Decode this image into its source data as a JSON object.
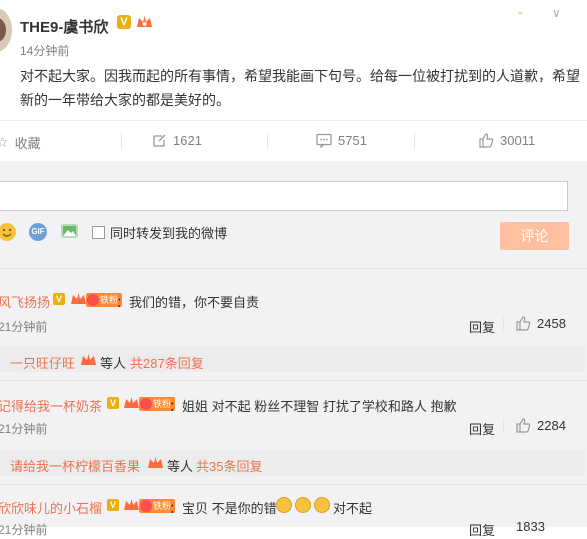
{
  "post": {
    "author": "THE9-虞书欣",
    "verified_badge": "V",
    "time": "14分钟前",
    "content": "对不起大家。因我而起的所有事情，希望我能画下句号。给每一位被打扰到的人道歉，希望新的一年带给大家的都是美好的。"
  },
  "actions": {
    "favorite_label": "收藏",
    "repost_count": "1621",
    "comment_count": "5751",
    "like_count": "30011"
  },
  "composer": {
    "placeholder": "",
    "gif_label": "GIF",
    "repost_checkbox_label": "同时转发到我的微博",
    "submit_label": "评论"
  },
  "comments": [
    {
      "user": "风飞扬扬",
      "fan_badge": "铁粉",
      "text": "：我们的错，你不要自责",
      "time": "21分钟前",
      "reply_label": "回复",
      "likes": "2458",
      "sub_user": "一只旺仔旺",
      "sub_mid": "等人",
      "sub_count": "共287条回复"
    },
    {
      "user": "记得给我一杯奶茶",
      "verified_badge": "V",
      "fan_badge": "铁粉",
      "text": "：姐姐 对不起 粉丝不理智 打扰了学校和路人 抱歉",
      "time": "21分钟前",
      "reply_label": "回复",
      "likes": "2284",
      "sub_user": "请给我一杯柠檬百香果",
      "sub_mid": "等人",
      "sub_count": "共35条回复"
    },
    {
      "user": "欣欣味儿的小石榴",
      "fan_badge": "铁粉",
      "text_a": "：宝贝 不是你的错",
      "text_b": "对不起",
      "time": "21分钟前",
      "reply_label": "回复",
      "likes": "1833"
    }
  ],
  "colors": {
    "link_orange": "#eb7350",
    "submit_bg": "#ffc09f",
    "verified_gold": "#e8b10e"
  }
}
